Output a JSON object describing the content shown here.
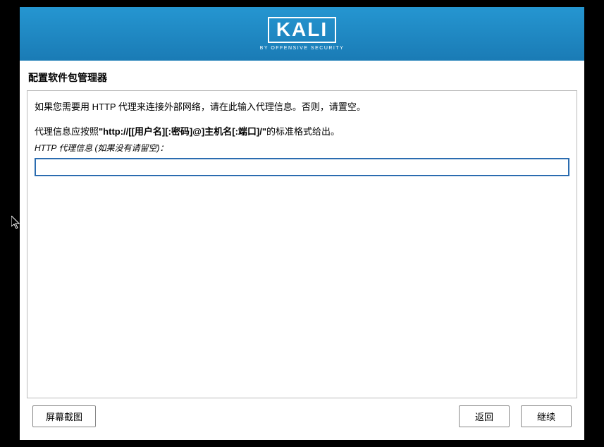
{
  "header": {
    "logo_text": "KALI",
    "logo_subtitle": "BY OFFENSIVE SECURITY"
  },
  "page": {
    "title": "配置软件包管理器"
  },
  "content": {
    "instruction1": "如果您需要用 HTTP 代理来连接外部网络，请在此输入代理信息。否则，请置空。",
    "instruction2_prefix": "代理信息应按照",
    "instruction2_format": "\"http://[[用户名][:密码]@]主机名[:端口]/\"",
    "instruction2_suffix": "的标准格式给出。",
    "field_label": "HTTP 代理信息 (如果没有请留空)：",
    "proxy_value": ""
  },
  "footer": {
    "screenshot": "屏幕截图",
    "back": "返回",
    "continue": "继续"
  }
}
